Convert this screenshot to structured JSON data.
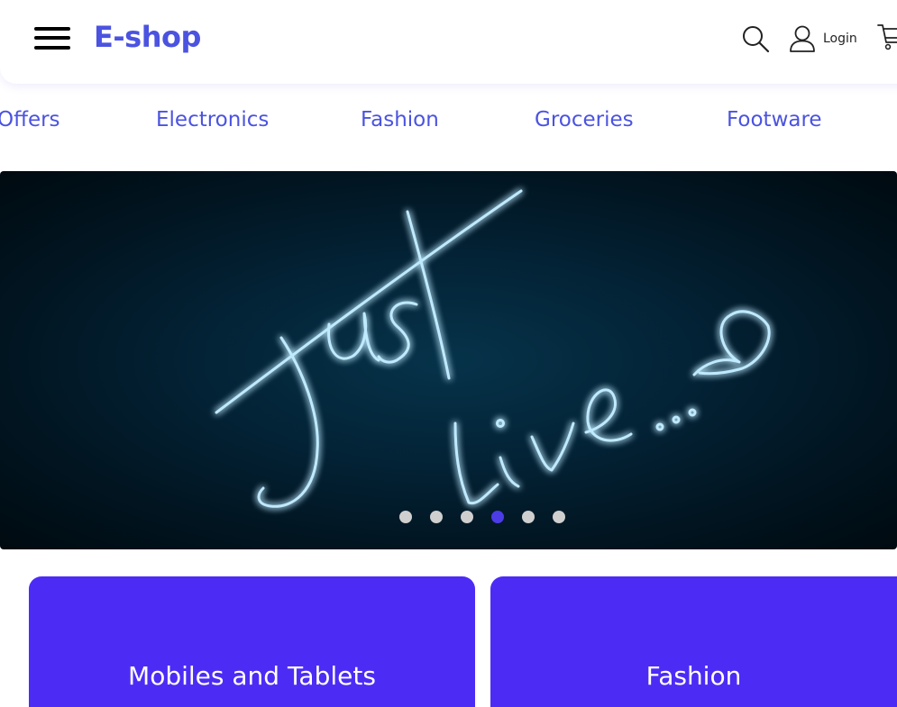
{
  "header": {
    "brand": "E-shop",
    "login_label": "Login"
  },
  "icons": {
    "menu": "hamburger-menu-icon",
    "search": "search-icon",
    "user": "user-icon",
    "cart": "cart-icon"
  },
  "categories": [
    {
      "label": "Offers"
    },
    {
      "label": "Electronics"
    },
    {
      "label": "Fashion"
    },
    {
      "label": "Groceries"
    },
    {
      "label": "Footware"
    }
  ],
  "hero": {
    "slide_count": 6,
    "active_slide": 4
  },
  "cards": [
    {
      "title": "Mobiles and Tablets"
    },
    {
      "title": "Fashion"
    }
  ],
  "colors": {
    "brand": "#4b53e0",
    "card_bg": "#4c2cf5",
    "dot_active": "#4b3ce6",
    "dot_inactive": "#cfcfcf"
  }
}
